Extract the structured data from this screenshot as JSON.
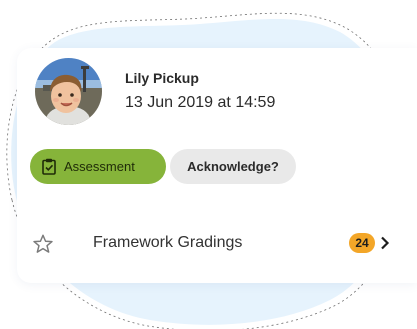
{
  "colors": {
    "accent_green": "#86b43a",
    "badge_orange": "#f3a628",
    "chip_grey": "#e9e9e9",
    "blob_blue": "#e6f3fd",
    "text": "#2b2b2b"
  },
  "entry": {
    "avatar_icon": "child-photo-avatar",
    "user_name": "Lily Pickup",
    "timestamp": "13 Jun 2019 at 14:59"
  },
  "chips": {
    "assessment": {
      "icon": "clipboard-check-icon",
      "label": "Assessment"
    },
    "acknowledge": {
      "label": "Acknowledge?"
    }
  },
  "framework_row": {
    "icon": "star-outline-icon",
    "label": "Framework Gradings",
    "count": "24",
    "chevron_icon": "chevron-right-icon"
  }
}
